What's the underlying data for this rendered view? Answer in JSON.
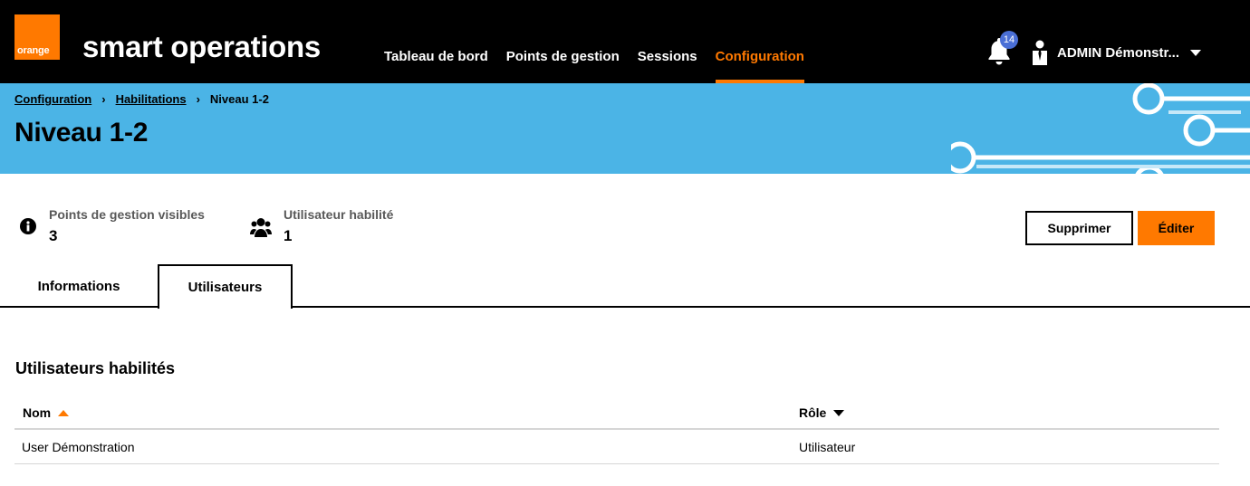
{
  "header": {
    "logo_text": "orange",
    "app_title": "smart operations",
    "nav": [
      {
        "label": "Tableau de bord"
      },
      {
        "label": "Points de gestion"
      },
      {
        "label": "Sessions"
      },
      {
        "label": "Configuration",
        "active": true
      }
    ],
    "notifications_count": "14",
    "user_name": "ADMIN Démonstr...",
    "icons": {
      "bell": "bell-icon",
      "user": "user-icon",
      "caret": "chevron-down-icon"
    }
  },
  "breadcrumb": [
    {
      "label": "Configuration"
    },
    {
      "label": "Habilitations"
    },
    {
      "label": "Niveau 1-2"
    }
  ],
  "page_title": "Niveau 1-2",
  "stats": [
    {
      "label": "Points de gestion visibles",
      "value": "3",
      "icon": "info-icon"
    },
    {
      "label": "Utilisateur habilité",
      "value": "1",
      "icon": "users-icon"
    }
  ],
  "actions": {
    "delete_label": "Supprimer",
    "edit_label": "Éditer"
  },
  "tabs": [
    {
      "label": "Informations"
    },
    {
      "label": "Utilisateurs",
      "active": true
    }
  ],
  "section_title": "Utilisateurs habilités",
  "table": {
    "columns": [
      {
        "label": "Nom",
        "sort": "asc"
      },
      {
        "label": "Rôle",
        "sort": "desc"
      }
    ],
    "rows": [
      {
        "name": "User Démonstration",
        "role": "Utilisateur"
      }
    ]
  },
  "colors": {
    "accent": "#ff7900",
    "banner": "#4bb4e6",
    "badge": "#4a6fd6"
  }
}
